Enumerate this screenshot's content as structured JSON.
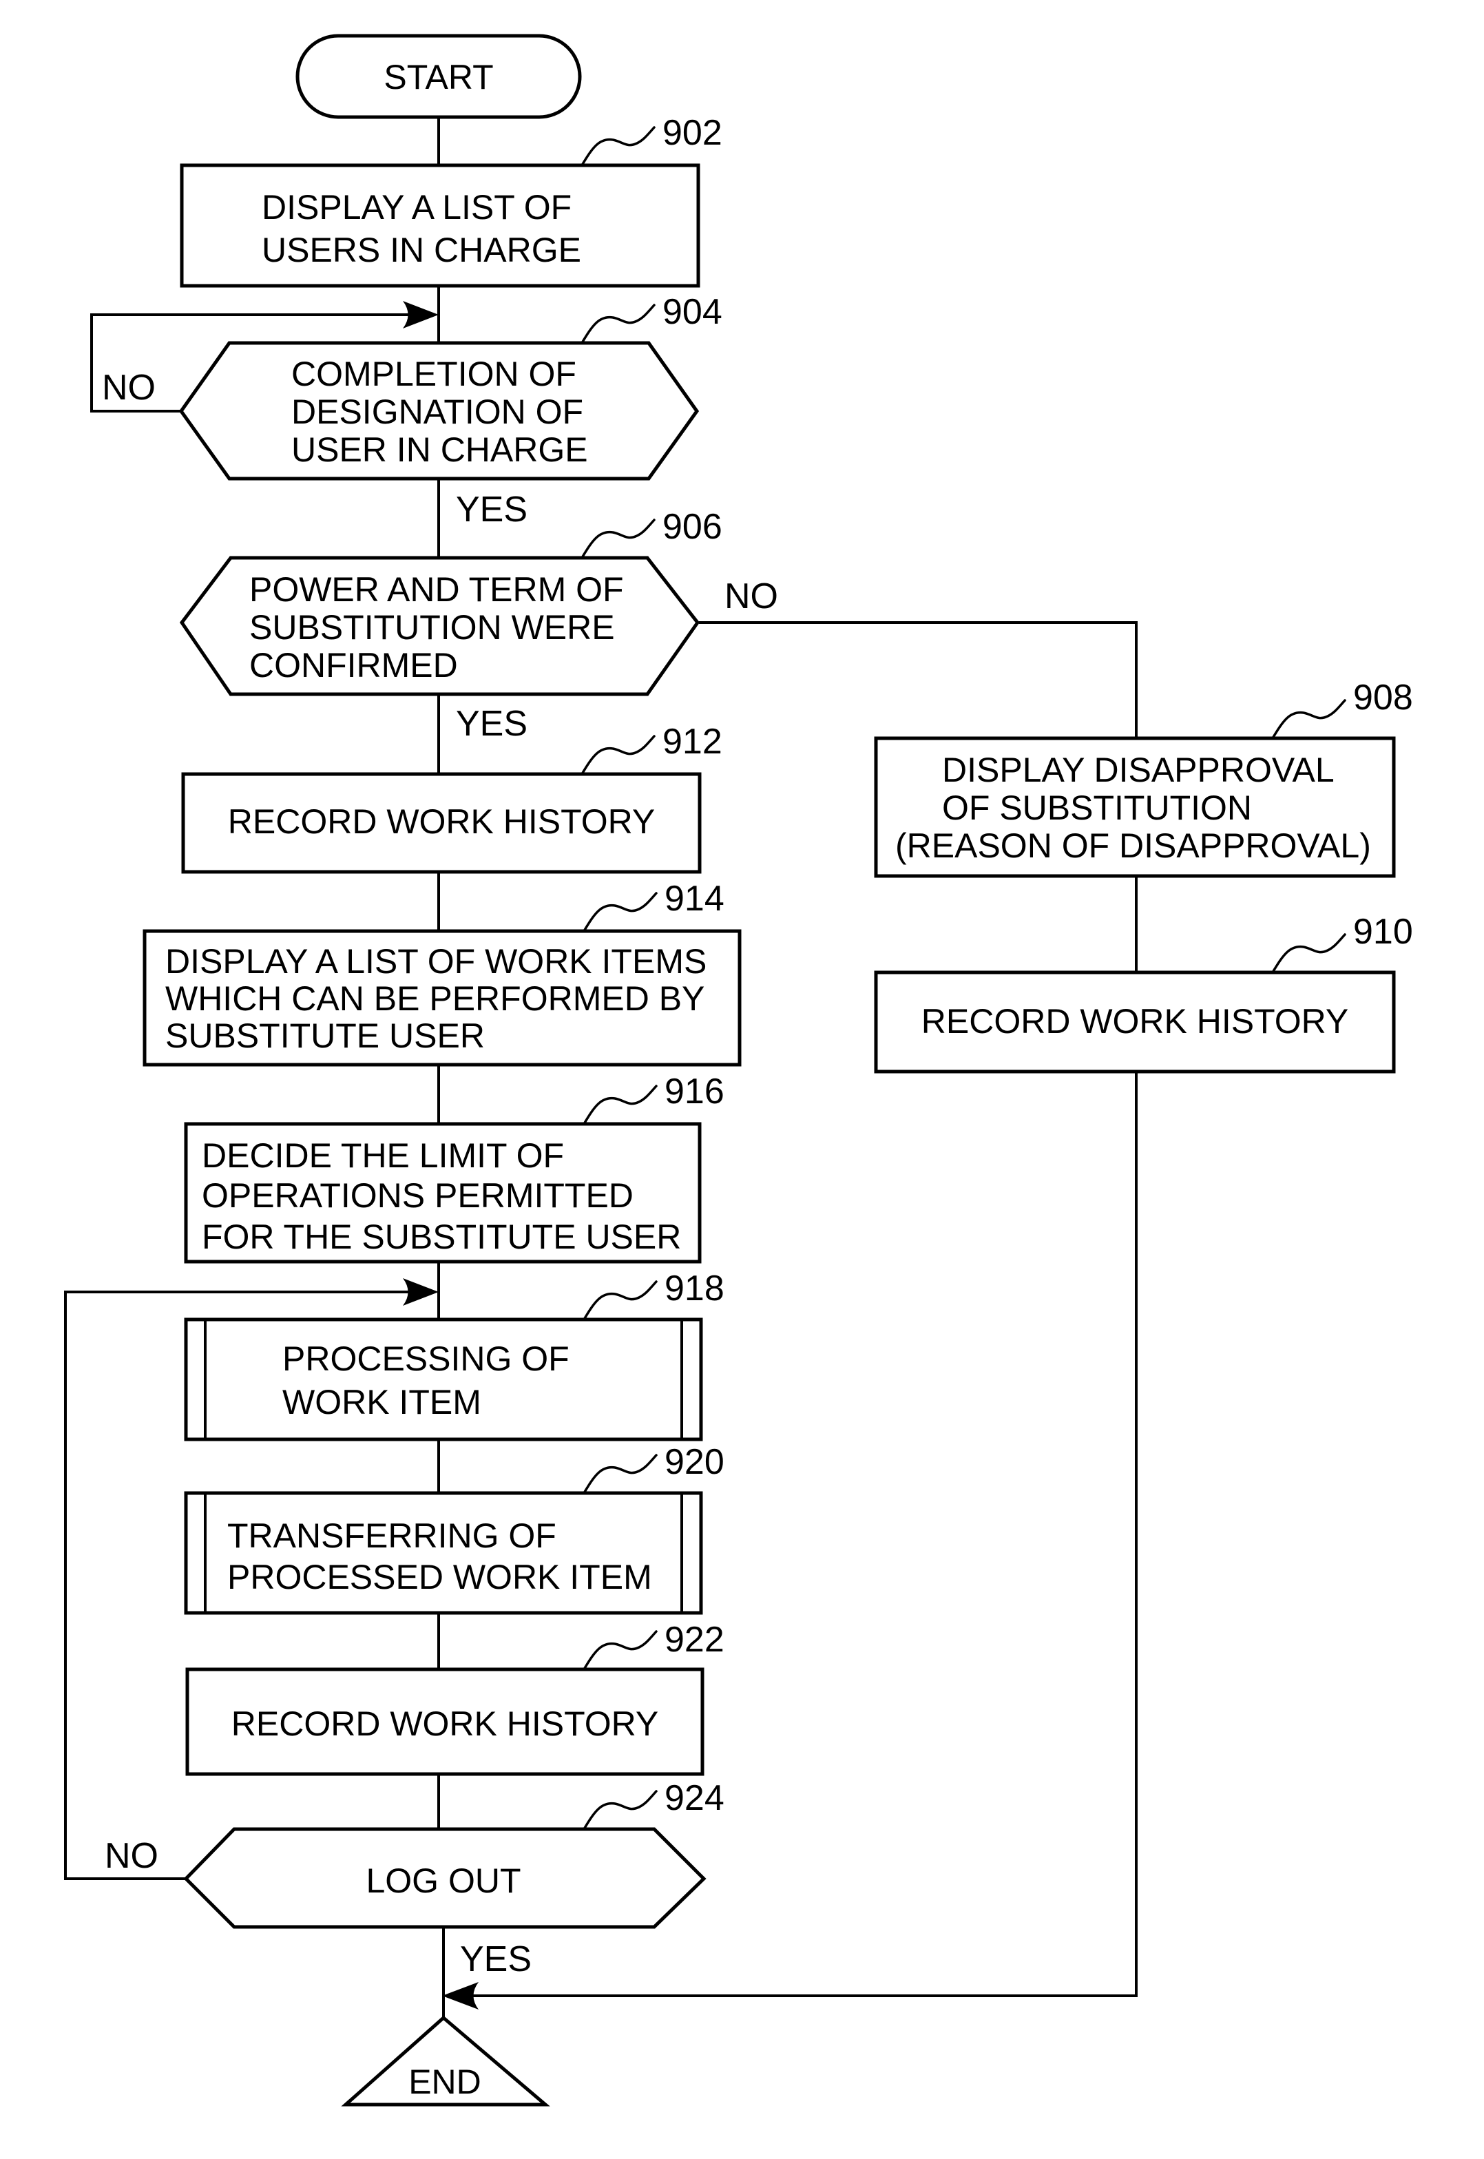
{
  "diagram": {
    "type": "flowchart",
    "nodes": {
      "start": {
        "kind": "terminal",
        "lines": [
          "START"
        ]
      },
      "n902": {
        "kind": "process",
        "ref": "902",
        "lines": [
          "DISPLAY A LIST OF",
          "USERS IN CHARGE"
        ]
      },
      "n904": {
        "kind": "decision",
        "ref": "904",
        "lines": [
          "COMPLETION OF",
          "DESIGNATION OF",
          "USER IN CHARGE"
        ],
        "no_label": "NO",
        "yes_label": "YES"
      },
      "n906": {
        "kind": "decision",
        "ref": "906",
        "lines": [
          "POWER AND TERM OF",
          "SUBSTITUTION WERE",
          "CONFIRMED"
        ],
        "no_label": "NO",
        "yes_label": "YES"
      },
      "n908": {
        "kind": "process",
        "ref": "908",
        "lines": [
          "DISPLAY DISAPPROVAL",
          "OF SUBSTITUTION",
          "(REASON OF DISAPPROVAL)"
        ]
      },
      "n910": {
        "kind": "process",
        "ref": "910",
        "lines": [
          "RECORD WORK HISTORY"
        ]
      },
      "n912": {
        "kind": "process",
        "ref": "912",
        "lines": [
          "RECORD WORK HISTORY"
        ]
      },
      "n914": {
        "kind": "process",
        "ref": "914",
        "lines": [
          "DISPLAY A LIST OF WORK ITEMS",
          "WHICH CAN BE PERFORMED BY",
          "SUBSTITUTE USER"
        ]
      },
      "n916": {
        "kind": "process",
        "ref": "916",
        "lines": [
          "DECIDE THE LIMIT OF",
          "OPERATIONS PERMITTED",
          "FOR THE SUBSTITUTE USER"
        ]
      },
      "n918": {
        "kind": "predefined-process",
        "ref": "918",
        "lines": [
          "PROCESSING OF",
          "WORK ITEM"
        ]
      },
      "n920": {
        "kind": "predefined-process",
        "ref": "920",
        "lines": [
          "TRANSFERRING OF",
          "PROCESSED WORK ITEM"
        ]
      },
      "n922": {
        "kind": "process",
        "ref": "922",
        "lines": [
          "RECORD WORK HISTORY"
        ]
      },
      "n924": {
        "kind": "decision",
        "ref": "924",
        "lines": [
          "LOG OUT"
        ],
        "no_label": "NO",
        "yes_label": "YES"
      },
      "end": {
        "kind": "terminal-triangle",
        "lines": [
          "END"
        ]
      }
    },
    "edges": [
      {
        "from": "start",
        "to": "n902",
        "label": ""
      },
      {
        "from": "n902",
        "to": "n904",
        "label": ""
      },
      {
        "from": "n904",
        "to": "n904",
        "label": "NO"
      },
      {
        "from": "n904",
        "to": "n906",
        "label": "YES"
      },
      {
        "from": "n906",
        "to": "n908",
        "label": "NO"
      },
      {
        "from": "n906",
        "to": "n912",
        "label": "YES"
      },
      {
        "from": "n908",
        "to": "n910",
        "label": ""
      },
      {
        "from": "n910",
        "to": "end",
        "label": ""
      },
      {
        "from": "n912",
        "to": "n914",
        "label": ""
      },
      {
        "from": "n914",
        "to": "n916",
        "label": ""
      },
      {
        "from": "n916",
        "to": "n918",
        "label": ""
      },
      {
        "from": "n918",
        "to": "n920",
        "label": ""
      },
      {
        "from": "n920",
        "to": "n922",
        "label": ""
      },
      {
        "from": "n922",
        "to": "n924",
        "label": ""
      },
      {
        "from": "n924",
        "to": "n918",
        "label": "NO"
      },
      {
        "from": "n924",
        "to": "end",
        "label": "YES"
      }
    ]
  }
}
